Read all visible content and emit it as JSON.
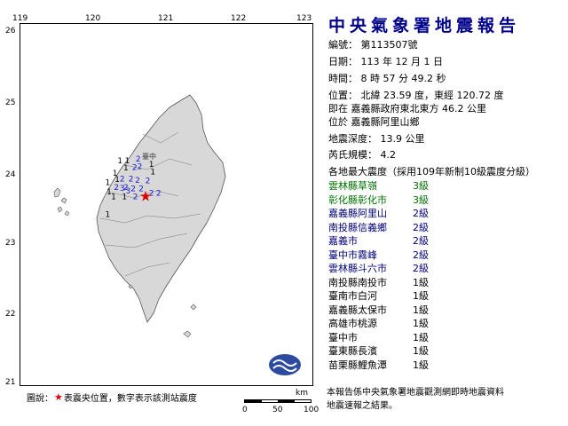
{
  "map": {
    "lon_ticks": [
      "119",
      "120",
      "121",
      "122",
      "123"
    ],
    "lat_ticks": [
      "26",
      "25",
      "24",
      "23",
      "22",
      "21"
    ],
    "epicenter": {
      "lon": 120.72,
      "lat": 23.59
    },
    "city_label": "臺中",
    "intensity_markers": [
      {
        "v": "2",
        "lon": 120.62,
        "lat": 24.08
      },
      {
        "v": "2",
        "lon": 120.64,
        "lat": 23.97
      },
      {
        "v": "2",
        "lon": 120.57,
        "lat": 23.96
      },
      {
        "v": "1",
        "lon": 120.47,
        "lat": 24.05
      },
      {
        "v": "1",
        "lon": 120.37,
        "lat": 24.05
      },
      {
        "v": "1",
        "lon": 120.8,
        "lat": 24.0
      },
      {
        "v": "1",
        "lon": 120.82,
        "lat": 23.9
      },
      {
        "v": "1",
        "lon": 120.45,
        "lat": 23.95
      },
      {
        "v": "1",
        "lon": 120.3,
        "lat": 23.88
      },
      {
        "v": "2",
        "lon": 120.4,
        "lat": 23.8
      },
      {
        "v": "2",
        "lon": 120.52,
        "lat": 23.8
      },
      {
        "v": "2",
        "lon": 120.61,
        "lat": 23.78
      },
      {
        "v": "2",
        "lon": 120.75,
        "lat": 23.77
      },
      {
        "v": "1",
        "lon": 120.33,
        "lat": 23.79
      },
      {
        "v": "1",
        "lon": 120.2,
        "lat": 23.75
      },
      {
        "v": "2",
        "lon": 120.32,
        "lat": 23.68
      },
      {
        "v": "2",
        "lon": 120.45,
        "lat": 23.68
      },
      {
        "v": "2",
        "lon": 120.55,
        "lat": 23.66
      },
      {
        "v": "2",
        "lon": 120.66,
        "lat": 23.66
      },
      {
        "v": "2",
        "lon": 120.8,
        "lat": 23.6
      },
      {
        "v": "2",
        "lon": 120.9,
        "lat": 23.6
      },
      {
        "v": "3",
        "lon": 120.4,
        "lat": 23.67
      },
      {
        "v": "3",
        "lon": 120.48,
        "lat": 23.63
      },
      {
        "v": "1",
        "lon": 120.22,
        "lat": 23.62
      },
      {
        "v": "1",
        "lon": 120.28,
        "lat": 23.55
      },
      {
        "v": "1",
        "lon": 120.43,
        "lat": 23.55
      },
      {
        "v": "2",
        "lon": 120.58,
        "lat": 23.55
      },
      {
        "v": "1",
        "lon": 120.2,
        "lat": 23.3
      }
    ],
    "legend": {
      "prefix": "圖說：",
      "star": "★",
      "suffix": "表震央位置，數字表示該測站震度"
    },
    "scale": {
      "unit": "km",
      "ticks": [
        "0",
        "50",
        "100"
      ]
    },
    "colors": {
      "land": "#d8d8d8",
      "coast": "#555555",
      "star": "#e00000",
      "marker": "#1a1ad0",
      "logo": "#2c4aa0"
    }
  },
  "report": {
    "title": "中央氣象署地震報告",
    "number": "編號： 第113507號",
    "date": "日期： 113 年 12 月 1 日",
    "time": "時間： 8 時 57 分 49.2 秒",
    "position": "位置： 北緯 23.59 度，東經 120.72 度",
    "rel_line1": "即在 嘉義縣政府東北東方 46.2 公里",
    "rel_line2": "位於 嘉義縣阿里山鄉",
    "depth": "地震深度： 13.9 公里",
    "magnitude": "芮氏規模： 4.2",
    "intensity_header": "各地最大震度（採用109年新制10級震度分級）",
    "stations": [
      {
        "name": "雲林縣草嶺",
        "level": "3級",
        "color": "green"
      },
      {
        "name": "彰化縣彰化市",
        "level": "3級",
        "color": "green"
      },
      {
        "name": "嘉義縣阿里山",
        "level": "2級",
        "color": "blue"
      },
      {
        "name": "南投縣信義鄉",
        "level": "2級",
        "color": "blue"
      },
      {
        "name": "嘉義市",
        "level": "2級",
        "color": "blue"
      },
      {
        "name": "臺中市霧峰",
        "level": "2級",
        "color": "blue"
      },
      {
        "name": "雲林縣斗六市",
        "level": "2級",
        "color": "blue"
      },
      {
        "name": "南投縣南投市",
        "level": "1級",
        "color": "black"
      },
      {
        "name": "臺南市白河",
        "level": "1級",
        "color": "black"
      },
      {
        "name": "嘉義縣太保市",
        "level": "1級",
        "color": "black"
      },
      {
        "name": "高雄市桃源",
        "level": "1級",
        "color": "black"
      },
      {
        "name": "臺中市",
        "level": "1級",
        "color": "black"
      },
      {
        "name": "臺東縣長濱",
        "level": "1級",
        "color": "black"
      },
      {
        "name": "苗栗縣鯉魚潭",
        "level": "1級",
        "color": "black"
      }
    ],
    "footer1": "本報告係中央氣象署地震觀測網即時地震資料",
    "footer2": "地震速報之結果。"
  }
}
